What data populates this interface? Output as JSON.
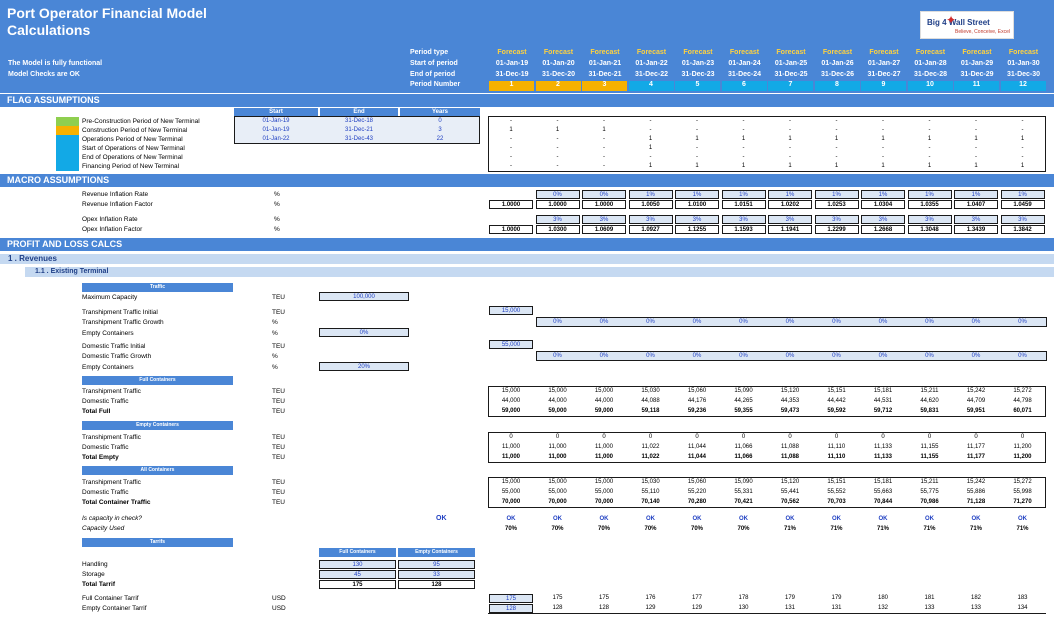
{
  "app": {
    "title": "Port Operator Financial Model",
    "subtitle": "Calculations",
    "status1": "The Model is fully functional",
    "status2": "Model Checks are OK",
    "logo_title": "Big 4 Wall Street",
    "logo_sub": "Believe, Conceive, Excel"
  },
  "periods": {
    "labels": [
      "Period type",
      "Start of period",
      "End of period",
      "Period Number"
    ],
    "type": [
      "Forecast",
      "Forecast",
      "Forecast",
      "Forecast",
      "Forecast",
      "Forecast",
      "Forecast",
      "Forecast",
      "Forecast",
      "Forecast",
      "Forecast",
      "Forecast"
    ],
    "start": [
      "01-Jan-19",
      "01-Jan-20",
      "01-Jan-21",
      "01-Jan-22",
      "01-Jan-23",
      "01-Jan-24",
      "01-Jan-25",
      "01-Jan-26",
      "01-Jan-27",
      "01-Jan-28",
      "01-Jan-29",
      "01-Jan-30"
    ],
    "end": [
      "31-Dec-19",
      "31-Dec-20",
      "31-Dec-21",
      "31-Dec-22",
      "31-Dec-23",
      "31-Dec-24",
      "31-Dec-25",
      "31-Dec-26",
      "31-Dec-27",
      "31-Dec-28",
      "31-Dec-29",
      "31-Dec-30"
    ],
    "number": [
      "1",
      "2",
      "3",
      "4",
      "5",
      "6",
      "7",
      "8",
      "9",
      "10",
      "11",
      "12"
    ],
    "colors": {
      "construction": "#f6b100",
      "operations": "#12a9e6"
    }
  },
  "sections": {
    "flag": "FLAG ASSUMPTIONS",
    "macro": "MACRO ASSUMPTIONS",
    "pl": "PROFIT AND LOSS CALCS",
    "revenues": "1 . Revenues",
    "existing": "1.1 . Existing Terminal"
  },
  "flags": {
    "headers": [
      "Start",
      "End",
      "Years"
    ],
    "rows": [
      {
        "label": "Pre-Construction Period of New Terminal",
        "start": "01-Jan-19",
        "end": "31-Dec-18",
        "years": "0",
        "vals": [
          "-",
          "-",
          "-",
          "-",
          "-",
          "-",
          "-",
          "-",
          "-",
          "-",
          "-",
          "-"
        ]
      },
      {
        "label": "Construction Period of New Terminal",
        "start": "01-Jan-19",
        "end": "31-Dec-21",
        "years": "3",
        "vals": [
          "1",
          "1",
          "1",
          "-",
          "-",
          "-",
          "-",
          "-",
          "-",
          "-",
          "-",
          "-"
        ]
      },
      {
        "label": "Operations Period of New Terminal",
        "start": "01-Jan-22",
        "end": "31-Dec-43",
        "years": "22",
        "vals": [
          "-",
          "-",
          "-",
          "1",
          "1",
          "1",
          "1",
          "1",
          "1",
          "1",
          "1",
          "1"
        ]
      },
      {
        "label": "Start of Operations of New Terminal",
        "vals": [
          "-",
          "-",
          "-",
          "1",
          "-",
          "-",
          "-",
          "-",
          "-",
          "-",
          "-",
          "-"
        ]
      },
      {
        "label": "End of Operations of New Terminal",
        "vals": [
          "-",
          "-",
          "-",
          "-",
          "-",
          "-",
          "-",
          "-",
          "-",
          "-",
          "-",
          "-"
        ]
      },
      {
        "label": "Financing Period of New Terminal",
        "vals": [
          "-",
          "-",
          "-",
          "1",
          "1",
          "1",
          "1",
          "1",
          "1",
          "1",
          "1",
          "1"
        ]
      }
    ],
    "swatch_colors": [
      "#8fcf4f",
      "#f6b100",
      "#12a9e6"
    ]
  },
  "macro": {
    "rows": [
      {
        "label": "Revenue Inflation Rate",
        "unit": "%",
        "first": "",
        "vals": [
          "0%",
          "0%",
          "1%",
          "1%",
          "1%",
          "1%",
          "1%",
          "1%",
          "1%",
          "1%",
          "1%"
        ],
        "input": true
      },
      {
        "label": "Revenue Inflation Factor",
        "unit": "%",
        "first": "1.0000",
        "vals": [
          "1.0000",
          "1.0000",
          "1.0050",
          "1.0100",
          "1.0151",
          "1.0202",
          "1.0253",
          "1.0304",
          "1.0355",
          "1.0407",
          "1.0459"
        ],
        "bold": true
      },
      {
        "label": "Opex Inflation Rate",
        "unit": "%",
        "first": "",
        "vals": [
          "3%",
          "3%",
          "3%",
          "3%",
          "3%",
          "3%",
          "3%",
          "3%",
          "3%",
          "3%",
          "3%"
        ],
        "input": true
      },
      {
        "label": "Opex Inflation Factor",
        "unit": "%",
        "first": "1.0000",
        "vals": [
          "1.0300",
          "1.0609",
          "1.0927",
          "1.1255",
          "1.1593",
          "1.1941",
          "1.2299",
          "1.2668",
          "1.3048",
          "1.3439",
          "1.3842"
        ],
        "bold": true
      }
    ]
  },
  "traffic": {
    "bar_traffic": "Traffic",
    "max_capacity": {
      "label": "Maximum Capacity",
      "unit": "TEU",
      "value": "100,000"
    },
    "tranship_initial": {
      "label": "Transhipment Traffic  Initial",
      "unit": "TEU",
      "value": "15,000"
    },
    "tranship_growth": {
      "label": "Transhipment Traffic  Growth",
      "unit": "%",
      "vals": [
        "0%",
        "0%",
        "0%",
        "0%",
        "0%",
        "0%",
        "0%",
        "0%",
        "0%",
        "0%",
        "0%"
      ]
    },
    "empty1": {
      "label": "Empty Containers",
      "unit": "%",
      "value": "0%"
    },
    "domestic_initial": {
      "label": "Domestic Traffic  Initial",
      "unit": "TEU",
      "value": "55,000"
    },
    "domestic_growth": {
      "label": "Domestic Traffic  Growth",
      "unit": "%",
      "vals": [
        "0%",
        "0%",
        "0%",
        "0%",
        "0%",
        "0%",
        "0%",
        "0%",
        "0%",
        "0%",
        "0%"
      ]
    },
    "empty2": {
      "label": "Empty Containers",
      "unit": "%",
      "value": "20%"
    },
    "bar_full": "Full Containers",
    "full": [
      {
        "label": "Transhipment Traffic",
        "unit": "TEU",
        "vals": [
          "15,000",
          "15,000",
          "15,000",
          "15,030",
          "15,060",
          "15,090",
          "15,120",
          "15,151",
          "15,181",
          "15,211",
          "15,242",
          "15,272"
        ]
      },
      {
        "label": "Domestic Traffic",
        "unit": "TEU",
        "vals": [
          "44,000",
          "44,000",
          "44,000",
          "44,088",
          "44,176",
          "44,265",
          "44,353",
          "44,442",
          "44,531",
          "44,620",
          "44,709",
          "44,798"
        ]
      },
      {
        "label": "Total Full",
        "unit": "TEU",
        "vals": [
          "59,000",
          "59,000",
          "59,000",
          "59,118",
          "59,236",
          "59,355",
          "59,473",
          "59,592",
          "59,712",
          "59,831",
          "59,951",
          "60,071"
        ],
        "bold": true
      }
    ],
    "bar_empty": "Empty Containers",
    "empty": [
      {
        "label": "Transhipment Traffic",
        "unit": "TEU",
        "vals": [
          "0",
          "0",
          "0",
          "0",
          "0",
          "0",
          "0",
          "0",
          "0",
          "0",
          "0",
          "0"
        ]
      },
      {
        "label": "Domestic Traffic",
        "unit": "TEU",
        "vals": [
          "11,000",
          "11,000",
          "11,000",
          "11,022",
          "11,044",
          "11,066",
          "11,088",
          "11,110",
          "11,133",
          "11,155",
          "11,177",
          "11,200"
        ]
      },
      {
        "label": "Total Empty",
        "unit": "TEU",
        "vals": [
          "11,000",
          "11,000",
          "11,000",
          "11,022",
          "11,044",
          "11,066",
          "11,088",
          "11,110",
          "11,133",
          "11,155",
          "11,177",
          "11,200"
        ],
        "bold": true
      }
    ],
    "bar_all": "All Containers",
    "all": [
      {
        "label": "Transhipment Traffic",
        "unit": "TEU",
        "vals": [
          "15,000",
          "15,000",
          "15,000",
          "15,030",
          "15,060",
          "15,090",
          "15,120",
          "15,151",
          "15,181",
          "15,211",
          "15,242",
          "15,272"
        ]
      },
      {
        "label": "Domestic Traffic",
        "unit": "TEU",
        "vals": [
          "55,000",
          "55,000",
          "55,000",
          "55,110",
          "55,220",
          "55,331",
          "55,441",
          "55,552",
          "55,663",
          "55,775",
          "55,886",
          "55,998"
        ]
      },
      {
        "label": "Total Container Traffic",
        "unit": "TEU",
        "vals": [
          "70,000",
          "70,000",
          "70,000",
          "70,140",
          "70,280",
          "70,421",
          "70,562",
          "70,703",
          "70,844",
          "70,986",
          "71,128",
          "71,270"
        ],
        "bold": true
      }
    ],
    "capacity_check": {
      "label": "Is capacity in check?",
      "value": "OK",
      "vals": [
        "OK",
        "OK",
        "OK",
        "OK",
        "OK",
        "OK",
        "OK",
        "OK",
        "OK",
        "OK",
        "OK",
        "OK"
      ]
    },
    "capacity_used": {
      "label": "Capacity Used",
      "vals": [
        "70%",
        "70%",
        "70%",
        "70%",
        "70%",
        "70%",
        "71%",
        "71%",
        "71%",
        "71%",
        "71%",
        "71%"
      ]
    }
  },
  "tariffs": {
    "bar": "Tarrifs",
    "col_full": "Full Containers",
    "col_empty": "Empty Containers",
    "rows": [
      {
        "label": "Handling",
        "full": "130",
        "empty": "95"
      },
      {
        "label": "Storage",
        "full": "45",
        "empty": "33"
      },
      {
        "label": "Total Tarrif",
        "full": "175",
        "empty": "128"
      }
    ],
    "full_tariff": {
      "label": "Full Container Tarrif",
      "unit": "USD",
      "vals": [
        "175",
        "175",
        "175",
        "176",
        "177",
        "178",
        "179",
        "179",
        "180",
        "181",
        "182",
        "183"
      ]
    },
    "empty_tariff": {
      "label": "Empty Container Tarrif",
      "unit": "USD",
      "vals": [
        "128",
        "128",
        "128",
        "129",
        "129",
        "130",
        "131",
        "131",
        "132",
        "133",
        "133",
        "134"
      ]
    }
  }
}
